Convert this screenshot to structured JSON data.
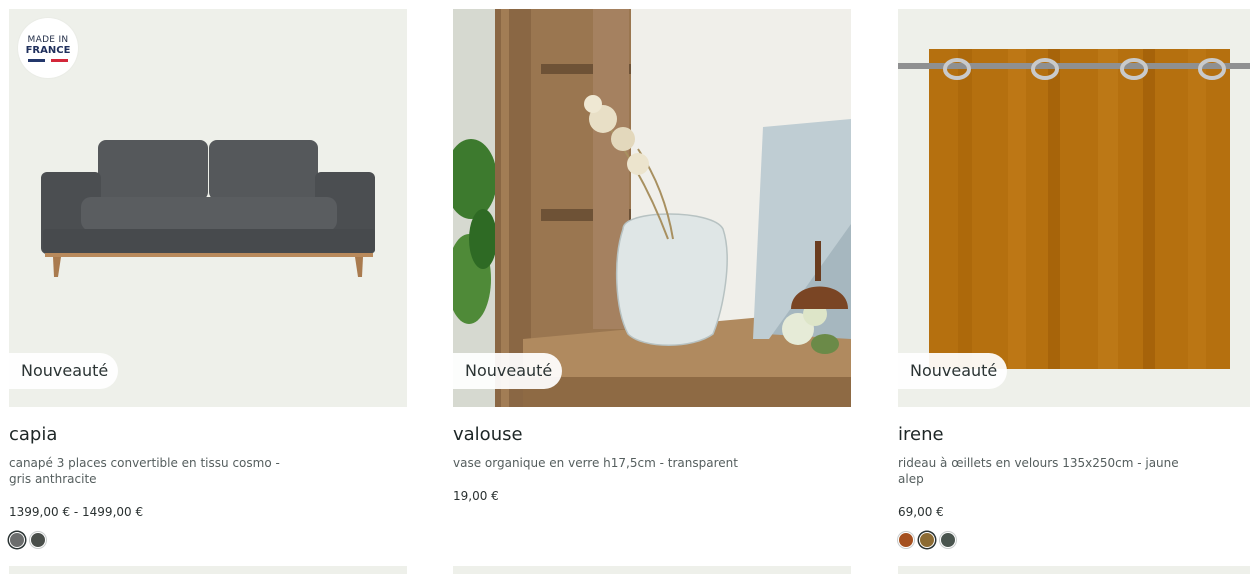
{
  "products": [
    {
      "name": "capia",
      "description": "canapé 3 places convertible en tissu cosmo - gris anthracite",
      "price": "1399,00 € - 1499,00 €",
      "badge": "Nouveauté",
      "made_in_badge": {
        "line1": "MADE IN",
        "line2": "FRANCE"
      },
      "swatches": [
        "#6b6d6d",
        "#4a4f4b"
      ],
      "selected_swatch": 0
    },
    {
      "name": "valouse",
      "description": "vase organique en verre h17,5cm - transparent",
      "price": "19,00 €",
      "badge": "Nouveauté",
      "swatches": []
    },
    {
      "name": "irene",
      "description": "rideau à œillets en velours 135x250cm - jaune alep",
      "price": "69,00 €",
      "badge": "Nouveauté",
      "swatches": [
        "#a5501f",
        "#8c6b33",
        "#4a554f"
      ],
      "selected_swatch": 1
    }
  ],
  "colors": {
    "image_bg": "#eef0ea",
    "sofa": "#4b4d50",
    "curtain": "#b5700f"
  }
}
